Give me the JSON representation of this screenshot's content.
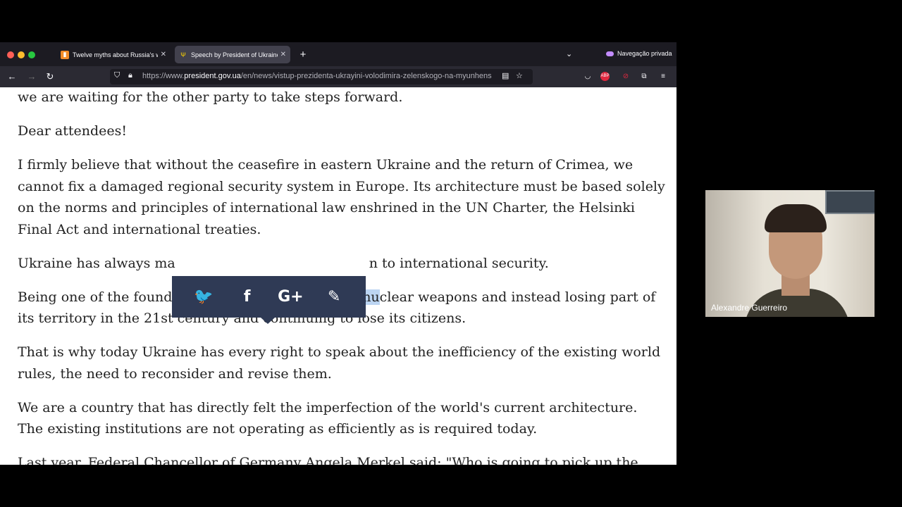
{
  "tabs": [
    {
      "title": "Twelve myths about Russia's wa",
      "active": false
    },
    {
      "title": "Speech by President of Ukraine",
      "active": true
    }
  ],
  "private_label": "Navegação privada",
  "url": {
    "prefix": "https://www.",
    "domain": "president.gov.ua",
    "path": "/en/news/vistup-prezidenta-ukrayini-volodimira-zelenskogo-na-myunhens"
  },
  "article": {
    "p0": "we are waiting for the other party to take steps forward.",
    "p1": "Dear attendees!",
    "p2": "I firmly believe that without the ceasefire in eastern Ukraine and the return of Crimea, we cannot fix a damaged regional security system in Europe. Its architecture must be based solely on the norms and principles of international law enshrined in the UN Charter, the Helsinki Final Act and international treaties.",
    "p3a": "Ukraine has always ma",
    "p3b": "n to international security.",
    "p4_before": "Being one of the founders of the UN. Giving up ",
    "p4_selected": "its nu",
    "p4_after": "clear weapons and instead losing part of its territory in the 21st century and continuing to lose its citizens.",
    "p5": "That is why today Ukraine has every right to speak about the inefficiency of the existing world rules, the need to reconsider and revise them.",
    "p6": "We are a country that has directly felt the imperfection of the world's current architecture. The existing institutions are not operating as efficiently as is required today.",
    "p7": "Last year, Federal Chancellor of Germany Angela Merkel said: \"Who is going to pick up the"
  },
  "share_icons": [
    "twitter-icon",
    "facebook-icon",
    "google-plus-icon",
    "pencil-icon"
  ],
  "share_glyphs": {
    "twitter": "🐦",
    "facebook": "f",
    "gplus": "G+",
    "pencil": "✎"
  },
  "webcam": {
    "name": "Alexandre Guerreiro"
  }
}
